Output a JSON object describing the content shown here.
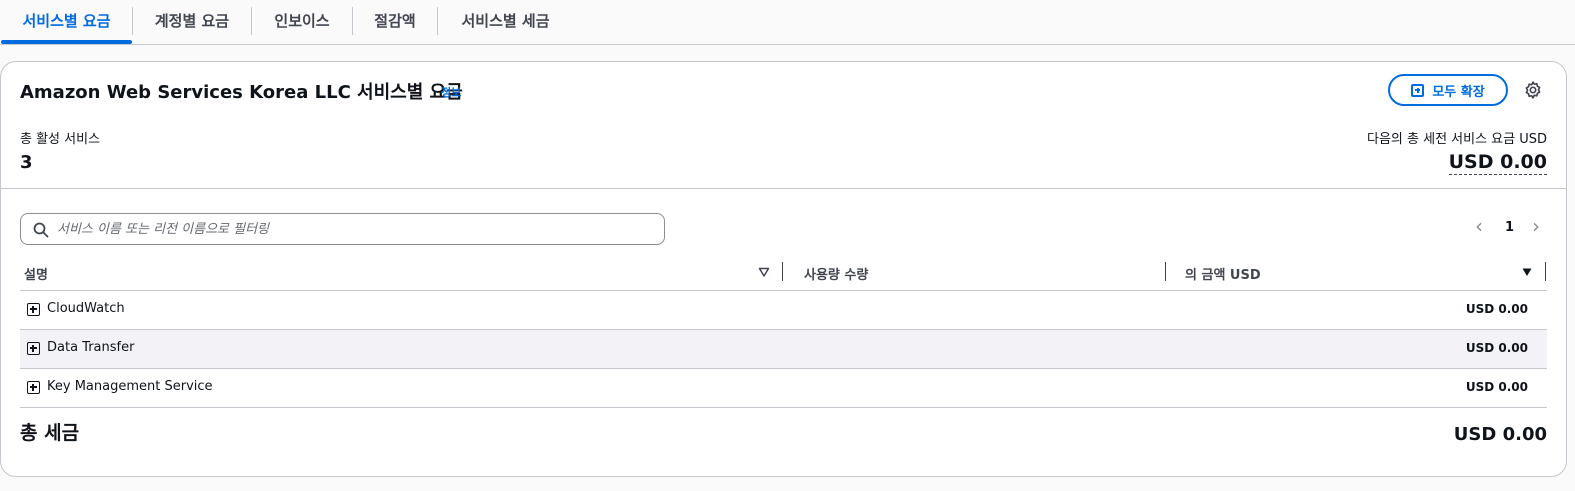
{
  "tabs": [
    {
      "label": "서비스별 요금",
      "active": true
    },
    {
      "label": "계정별 요금",
      "active": false
    },
    {
      "label": "인보이스",
      "active": false
    },
    {
      "label": "절감액",
      "active": false
    },
    {
      "label": "서비스별 세금",
      "active": false
    }
  ],
  "header": {
    "title": "Amazon Web Services Korea LLC 서비스별 요금",
    "info_link": "정보",
    "expand_all": "모두 확장",
    "settings_icon": "gear-icon"
  },
  "summary": {
    "active_label": "총 활성 서비스",
    "active_value": "3",
    "total_label": "다음의 총 세전 서비스 요금 USD",
    "total_value": "USD 0.00"
  },
  "search": {
    "placeholder": "서비스 이름 또는 리전 이름으로 필터링"
  },
  "pagination": {
    "prev": "‹",
    "page": "1",
    "next": "›"
  },
  "table": {
    "columns": [
      "설명",
      "사용량 수량",
      "의 금액 USD"
    ],
    "rows": [
      {
        "name": "CloudWatch",
        "amount": "USD 0.00"
      },
      {
        "name": "Data Transfer",
        "amount": "USD 0.00"
      },
      {
        "name": "Key Management Service",
        "amount": "USD 0.00"
      }
    ]
  },
  "footer": {
    "label": "총 세금",
    "value": "USD 0.00"
  },
  "colors": {
    "accent": "#006ce0",
    "border": "#c6c6cd",
    "text": "#0f141a"
  }
}
